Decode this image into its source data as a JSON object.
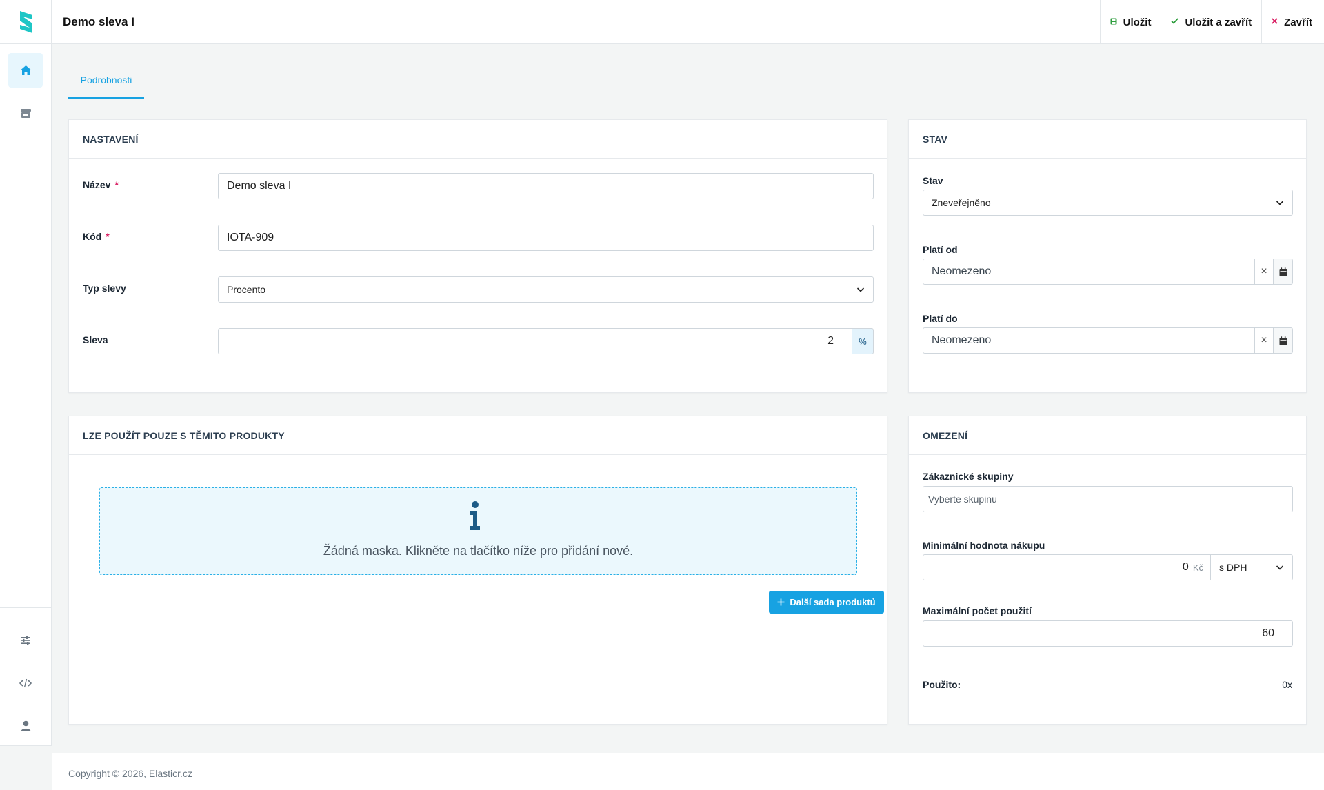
{
  "header": {
    "title": "Demo sleva I",
    "actions": {
      "save": "Uložit",
      "save_close": "Uložit a zavřít",
      "close": "Zavřít"
    }
  },
  "sidebar": {
    "top_items": [
      "home-icon",
      "store-icon"
    ],
    "bottom_items": [
      "sliders-icon",
      "code-icon",
      "user-icon"
    ]
  },
  "tabs": {
    "details": "Podrobnosti"
  },
  "settings": {
    "title": "NASTAVENÍ",
    "name_label": "Název",
    "name_value": "Demo sleva I",
    "code_label": "Kód",
    "code_value": "IOTA-909",
    "type_label": "Typ slevy",
    "type_value": "Procento",
    "discount_label": "Sleva",
    "discount_value": "2",
    "discount_unit": "%",
    "required_mark": "*"
  },
  "status": {
    "title": "STAV",
    "state_label": "Stav",
    "state_value": "Zneveřejněno",
    "valid_from_label": "Platí od",
    "valid_from_value": "Neomezeno",
    "valid_to_label": "Platí do",
    "valid_to_value": "Neomezeno",
    "clear_symbol": "×"
  },
  "products": {
    "title": "LZE POUŽÍT POUZE S TĚMITO PRODUKTY",
    "empty_message": "Žádná maska. Klikněte na tlačítko níže pro přidání nové.",
    "add_button": "Další sada produktů"
  },
  "limits": {
    "title": "OMEZENÍ",
    "groups_label": "Zákaznické skupiny",
    "groups_placeholder": "Vyberte skupinu",
    "min_value_label": "Minimální hodnota nákupu",
    "min_value": "0",
    "currency": "Kč",
    "vat_value": "s DPH",
    "max_uses_label": "Maximální počet použití",
    "max_uses_value": "60",
    "used_label": "Použito:",
    "used_value": "0x"
  },
  "footer": {
    "copyright": "Copyright © 2026, Elasticr.cz"
  },
  "colors": {
    "accent": "#17a2e2",
    "required": "#d81b60",
    "save_icon": "#2e9e3e",
    "close_icon": "#d81b60"
  }
}
